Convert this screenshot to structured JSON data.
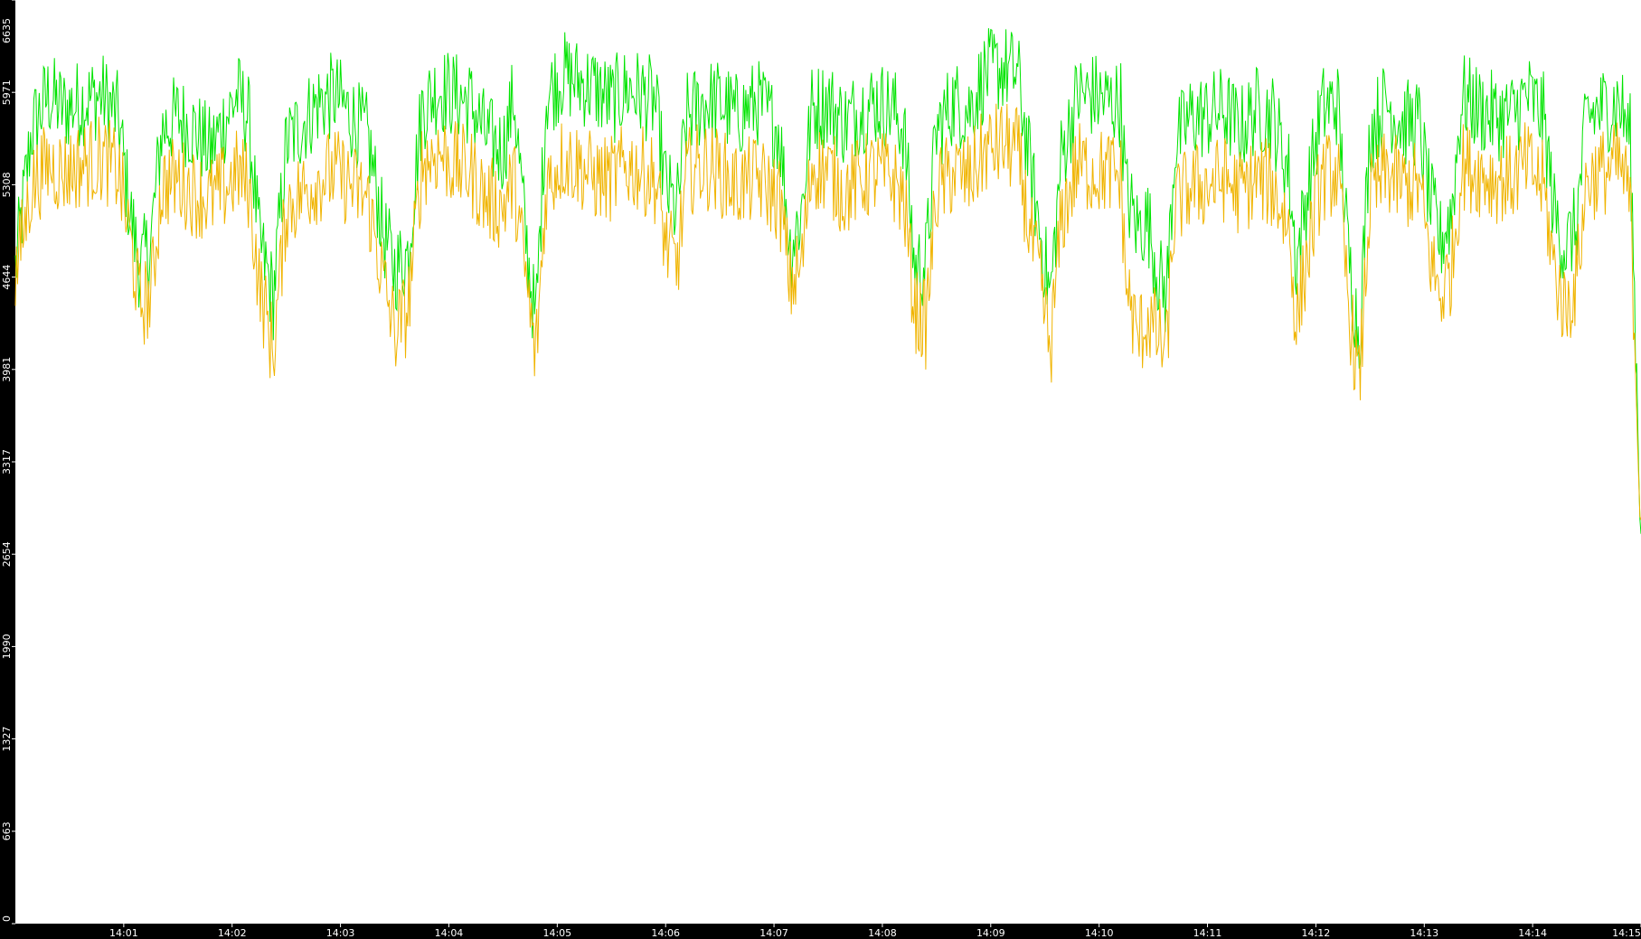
{
  "chart_data": {
    "type": "line",
    "title": "",
    "xlabel": "",
    "ylabel": "",
    "grid": false,
    "legend": "none",
    "ylim": [
      0,
      6635
    ],
    "xlim_minutes": [
      0,
      15
    ],
    "y_ticks": [
      "0",
      "663",
      "1327",
      "1990",
      "2654",
      "3317",
      "3981",
      "4644",
      "5308",
      "5971",
      "6635"
    ],
    "x_ticks": [
      {
        "label": "14:01",
        "minute": 1
      },
      {
        "label": "14:02",
        "minute": 2
      },
      {
        "label": "14:03",
        "minute": 3
      },
      {
        "label": "14:04",
        "minute": 4
      },
      {
        "label": "14:05",
        "minute": 5
      },
      {
        "label": "14:06",
        "minute": 6
      },
      {
        "label": "14:07",
        "minute": 7
      },
      {
        "label": "14:08",
        "minute": 8
      },
      {
        "label": "14:09",
        "minute": 9
      },
      {
        "label": "14:10",
        "minute": 10
      },
      {
        "label": "14:11",
        "minute": 11
      },
      {
        "label": "14:12",
        "minute": 12
      },
      {
        "label": "14:13",
        "minute": 13
      },
      {
        "label": "14:14",
        "minute": 14
      },
      {
        "label": "14:15",
        "minute": 15
      }
    ],
    "background": "#ffffff",
    "frame_color": "#000000",
    "series": [
      {
        "color": "#00e400",
        "values": [
          [
            0.0,
            4700
          ],
          [
            0.15,
            5700
          ],
          [
            0.3,
            5950
          ],
          [
            0.45,
            5850
          ],
          [
            0.6,
            5900
          ],
          [
            0.8,
            5950
          ],
          [
            0.95,
            5800
          ],
          [
            1.05,
            5150
          ],
          [
            1.15,
            4700
          ],
          [
            1.25,
            4900
          ],
          [
            1.35,
            5700
          ],
          [
            1.5,
            5800
          ],
          [
            1.65,
            5700
          ],
          [
            1.8,
            5550
          ],
          [
            1.95,
            5800
          ],
          [
            2.05,
            5950
          ],
          [
            2.15,
            5800
          ],
          [
            2.25,
            4900
          ],
          [
            2.38,
            4500
          ],
          [
            2.5,
            5600
          ],
          [
            2.65,
            5750
          ],
          [
            2.8,
            5900
          ],
          [
            2.95,
            5950
          ],
          [
            3.1,
            5800
          ],
          [
            3.25,
            5650
          ],
          [
            3.4,
            4950
          ],
          [
            3.5,
            4700
          ],
          [
            3.62,
            4800
          ],
          [
            3.75,
            5850
          ],
          [
            3.9,
            6000
          ],
          [
            4.05,
            5950
          ],
          [
            4.2,
            5900
          ],
          [
            4.35,
            5650
          ],
          [
            4.5,
            5550
          ],
          [
            4.6,
            5950
          ],
          [
            4.7,
            5000
          ],
          [
            4.8,
            4300
          ],
          [
            4.9,
            5950
          ],
          [
            5.05,
            6100
          ],
          [
            5.2,
            6050
          ],
          [
            5.35,
            6000
          ],
          [
            5.5,
            5900
          ],
          [
            5.65,
            6000
          ],
          [
            5.8,
            5950
          ],
          [
            5.9,
            5900
          ],
          [
            6.0,
            5300
          ],
          [
            6.1,
            5100
          ],
          [
            6.2,
            5800
          ],
          [
            6.35,
            5900
          ],
          [
            6.5,
            5900
          ],
          [
            6.65,
            5800
          ],
          [
            6.85,
            5900
          ],
          [
            7.05,
            5700
          ],
          [
            7.15,
            4850
          ],
          [
            7.25,
            5100
          ],
          [
            7.35,
            5850
          ],
          [
            7.5,
            5900
          ],
          [
            7.65,
            5750
          ],
          [
            7.8,
            5850
          ],
          [
            7.95,
            5900
          ],
          [
            8.1,
            5850
          ],
          [
            8.2,
            5700
          ],
          [
            8.3,
            4700
          ],
          [
            8.4,
            4750
          ],
          [
            8.5,
            5700
          ],
          [
            8.65,
            5900
          ],
          [
            8.8,
            5850
          ],
          [
            8.95,
            6100
          ],
          [
            9.1,
            6150
          ],
          [
            9.25,
            6100
          ],
          [
            9.35,
            5500
          ],
          [
            9.45,
            5000
          ],
          [
            9.55,
            4500
          ],
          [
            9.65,
            5500
          ],
          [
            9.8,
            5950
          ],
          [
            9.95,
            5950
          ],
          [
            10.1,
            5900
          ],
          [
            10.2,
            5900
          ],
          [
            10.25,
            5250
          ],
          [
            10.35,
            5000
          ],
          [
            10.45,
            5050
          ],
          [
            10.55,
            4650
          ],
          [
            10.62,
            4500
          ],
          [
            10.7,
            5600
          ],
          [
            10.85,
            5800
          ],
          [
            11.0,
            5800
          ],
          [
            11.15,
            5850
          ],
          [
            11.3,
            5700
          ],
          [
            11.45,
            5850
          ],
          [
            11.6,
            5800
          ],
          [
            11.75,
            5400
          ],
          [
            11.82,
            4750
          ],
          [
            11.9,
            5150
          ],
          [
            12.05,
            5850
          ],
          [
            12.2,
            5900
          ],
          [
            12.3,
            4800
          ],
          [
            12.4,
            4200
          ],
          [
            12.5,
            5700
          ],
          [
            12.65,
            5900
          ],
          [
            12.8,
            5750
          ],
          [
            12.95,
            5750
          ],
          [
            13.05,
            5200
          ],
          [
            13.15,
            4900
          ],
          [
            13.25,
            5100
          ],
          [
            13.35,
            5950
          ],
          [
            13.5,
            5850
          ],
          [
            13.65,
            5800
          ],
          [
            13.8,
            5800
          ],
          [
            13.95,
            5950
          ],
          [
            14.1,
            5800
          ],
          [
            14.2,
            5100
          ],
          [
            14.3,
            4850
          ],
          [
            14.4,
            5000
          ],
          [
            14.5,
            5800
          ],
          [
            14.65,
            5850
          ],
          [
            14.8,
            5900
          ],
          [
            14.9,
            5650
          ],
          [
            15.0,
            2800
          ]
        ]
      },
      {
        "color": "#f0b400",
        "values": [
          [
            0.0,
            4650
          ],
          [
            0.15,
            5300
          ],
          [
            0.3,
            5450
          ],
          [
            0.45,
            5400
          ],
          [
            0.6,
            5450
          ],
          [
            0.8,
            5500
          ],
          [
            0.95,
            5400
          ],
          [
            1.05,
            4950
          ],
          [
            1.15,
            4450
          ],
          [
            1.25,
            4500
          ],
          [
            1.35,
            5300
          ],
          [
            1.5,
            5350
          ],
          [
            1.65,
            5250
          ],
          [
            1.8,
            5200
          ],
          [
            1.95,
            5300
          ],
          [
            2.05,
            5400
          ],
          [
            2.15,
            5300
          ],
          [
            2.25,
            4600
          ],
          [
            2.38,
            4100
          ],
          [
            2.5,
            5150
          ],
          [
            2.65,
            5250
          ],
          [
            2.8,
            5350
          ],
          [
            2.95,
            5400
          ],
          [
            3.1,
            5300
          ],
          [
            3.25,
            5200
          ],
          [
            3.4,
            4600
          ],
          [
            3.5,
            4250
          ],
          [
            3.62,
            4400
          ],
          [
            3.75,
            5450
          ],
          [
            3.9,
            5550
          ],
          [
            4.05,
            5450
          ],
          [
            4.2,
            5400
          ],
          [
            4.35,
            5200
          ],
          [
            4.5,
            5150
          ],
          [
            4.6,
            5350
          ],
          [
            4.7,
            4700
          ],
          [
            4.8,
            4050
          ],
          [
            4.9,
            5300
          ],
          [
            5.05,
            5500
          ],
          [
            5.2,
            5450
          ],
          [
            5.35,
            5350
          ],
          [
            5.5,
            5350
          ],
          [
            5.65,
            5450
          ],
          [
            5.8,
            5400
          ],
          [
            5.9,
            5350
          ],
          [
            6.0,
            4900
          ],
          [
            6.1,
            4700
          ],
          [
            6.2,
            5400
          ],
          [
            6.35,
            5450
          ],
          [
            6.5,
            5400
          ],
          [
            6.65,
            5300
          ],
          [
            6.85,
            5350
          ],
          [
            7.05,
            5200
          ],
          [
            7.15,
            4600
          ],
          [
            7.25,
            4700
          ],
          [
            7.35,
            5450
          ],
          [
            7.5,
            5400
          ],
          [
            7.65,
            5250
          ],
          [
            7.8,
            5350
          ],
          [
            7.95,
            5400
          ],
          [
            8.1,
            5350
          ],
          [
            8.2,
            5200
          ],
          [
            8.3,
            4400
          ],
          [
            8.4,
            4300
          ],
          [
            8.5,
            5250
          ],
          [
            8.65,
            5400
          ],
          [
            8.8,
            5350
          ],
          [
            8.95,
            5550
          ],
          [
            9.1,
            5600
          ],
          [
            9.25,
            5550
          ],
          [
            9.35,
            5000
          ],
          [
            9.45,
            4650
          ],
          [
            9.55,
            4100
          ],
          [
            9.65,
            5050
          ],
          [
            9.8,
            5450
          ],
          [
            9.95,
            5400
          ],
          [
            10.1,
            5400
          ],
          [
            10.2,
            5350
          ],
          [
            10.25,
            4600
          ],
          [
            10.35,
            4200
          ],
          [
            10.45,
            4350
          ],
          [
            10.55,
            4200
          ],
          [
            10.62,
            4100
          ],
          [
            10.7,
            5150
          ],
          [
            10.85,
            5300
          ],
          [
            11.0,
            5300
          ],
          [
            11.15,
            5350
          ],
          [
            11.3,
            5250
          ],
          [
            11.45,
            5350
          ],
          [
            11.6,
            5300
          ],
          [
            11.75,
            5000
          ],
          [
            11.82,
            4300
          ],
          [
            11.9,
            4700
          ],
          [
            12.05,
            5350
          ],
          [
            12.2,
            5400
          ],
          [
            12.3,
            4450
          ],
          [
            12.4,
            3850
          ],
          [
            12.5,
            5200
          ],
          [
            12.65,
            5400
          ],
          [
            12.8,
            5300
          ],
          [
            12.95,
            5300
          ],
          [
            13.05,
            4800
          ],
          [
            13.15,
            4500
          ],
          [
            13.25,
            4700
          ],
          [
            13.35,
            5450
          ],
          [
            13.5,
            5400
          ],
          [
            13.65,
            5350
          ],
          [
            13.8,
            5350
          ],
          [
            13.95,
            5450
          ],
          [
            14.1,
            5300
          ],
          [
            14.2,
            4700
          ],
          [
            14.3,
            4400
          ],
          [
            14.4,
            4600
          ],
          [
            14.5,
            5350
          ],
          [
            14.65,
            5400
          ],
          [
            14.8,
            5450
          ],
          [
            14.9,
            5200
          ],
          [
            15.0,
            2900
          ]
        ]
      }
    ]
  }
}
